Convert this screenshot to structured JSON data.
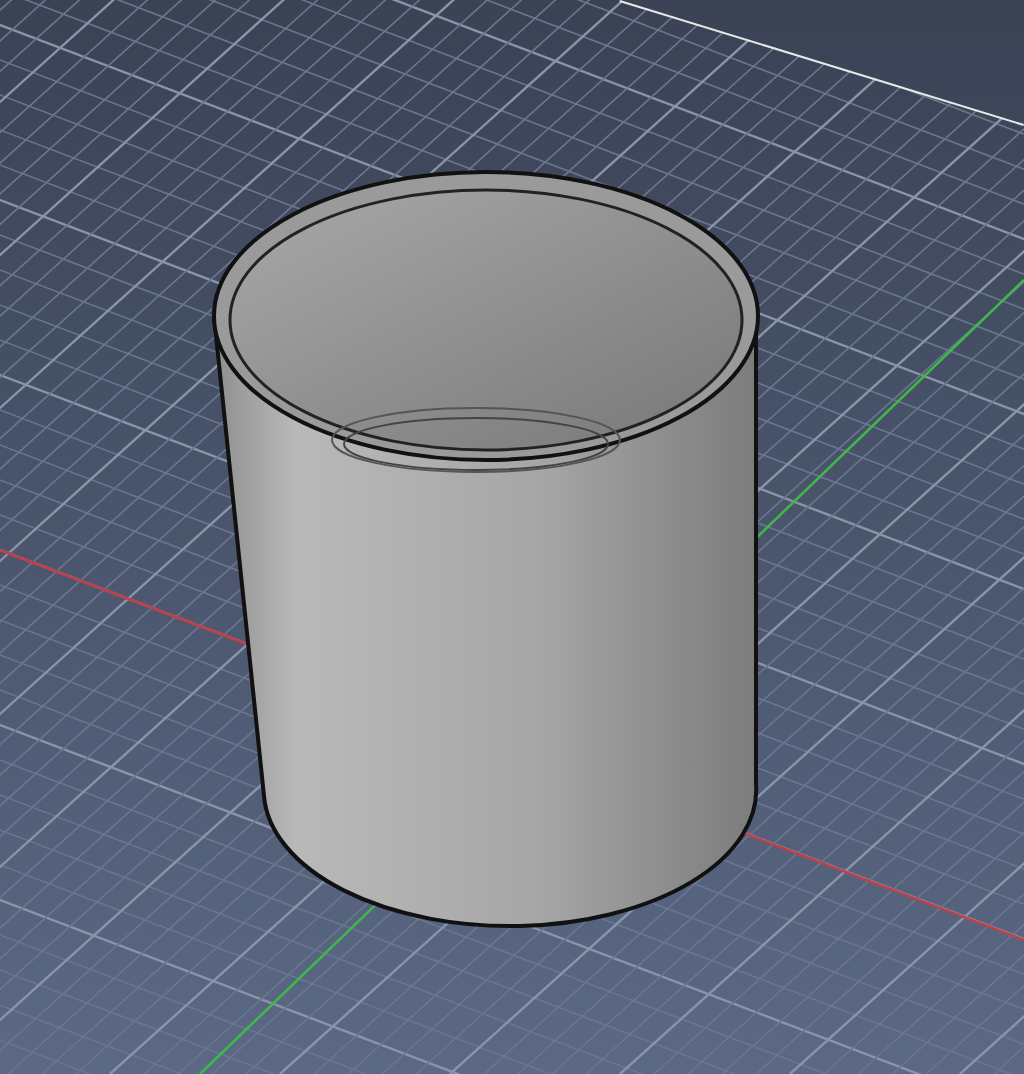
{
  "viewport": {
    "show_grid": true,
    "show_axes": true
  },
  "model": {
    "kind": "cylinder"
  }
}
